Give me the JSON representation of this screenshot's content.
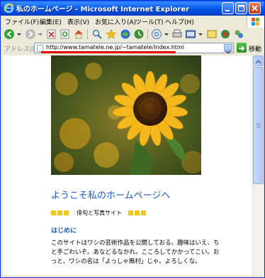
{
  "window": {
    "title": "私のホームページ - Microsoft Internet Explorer"
  },
  "menubar": {
    "items": [
      {
        "label": "ファイル(F)"
      },
      {
        "label": "編集(E)"
      },
      {
        "label": "表示(V)"
      },
      {
        "label": "お気に入り(A)"
      },
      {
        "label": "ツール(T)"
      },
      {
        "label": "ヘルプ(H)"
      }
    ]
  },
  "addressbar": {
    "label": "アドレス(D)",
    "url": "http://www.tamatele.ne.jp/~tamatele/index.html",
    "go_label": "移動"
  },
  "content": {
    "welcome_heading": "ようこそ私のホームページへ",
    "tagline": "俳句と写真サイト",
    "intro_heading": "はじめに",
    "intro_text": "このサイトはワシの芸術作品を公開しておる。趣味はいえ、ちと手ごわいぞ。あなどるなかれ。こころしてかかってこい。おっと、ワシの名は「よっしゃ無村」じゃ。よろしくな。"
  },
  "colors": {
    "title_bar": "#0a5ef0",
    "heading_blue": "#1a5bd6",
    "bullet_yellow": "#f2c51b",
    "highlight_red": "#e00000"
  }
}
